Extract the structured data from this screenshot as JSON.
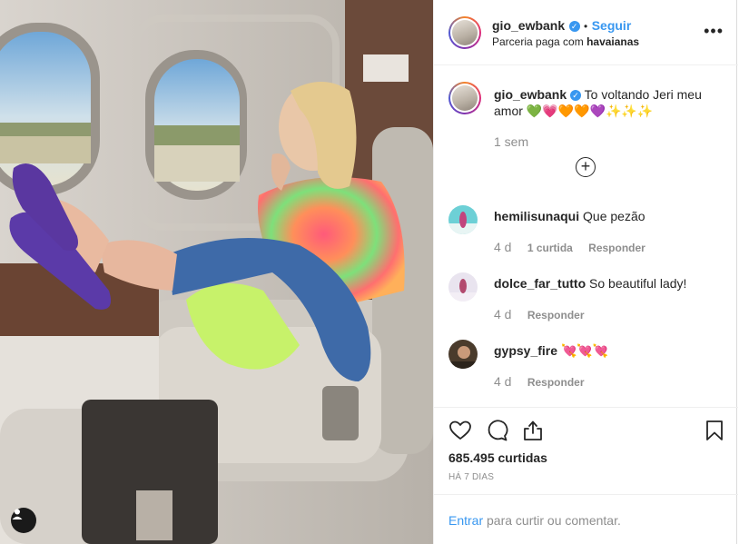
{
  "post": {
    "author": "gio_ewbank",
    "follow_label": "Seguir",
    "header_dot": "•",
    "partnership_prefix": "Parceria paga com",
    "partner": "havaianas",
    "more_icon": "more-horizontal-icon",
    "more_glyph": "•••"
  },
  "caption": {
    "author": "gio_ewbank",
    "text": "To voltando Jeri meu amor 💚💗🧡🧡💜✨✨✨",
    "time": "1 sem"
  },
  "load_more_glyph": "+",
  "comments": [
    {
      "username": "hemilisunaqui",
      "text": "Que pezão",
      "time": "4 d",
      "likes": "1 curtida",
      "reply": "Responder"
    },
    {
      "username": "dolce_far_tutto",
      "text": "So beautiful lady!",
      "time": "4 d",
      "likes": "",
      "reply": "Responder"
    },
    {
      "username": "gypsy_fire",
      "text": "💘💘💘",
      "time": "4 d",
      "likes": "",
      "reply": "Responder"
    }
  ],
  "footer": {
    "likes": "685.495 curtidas",
    "posted_ago": "HÁ 7 DIAS",
    "login_link": "Entrar",
    "login_suffix": "para curtir ou comentar."
  },
  "icons": {
    "like": "heart-icon",
    "comment": "comment-icon",
    "share": "share-icon",
    "save": "bookmark-icon",
    "photo_user": "user-tag-icon"
  },
  "colors": {
    "link_blue": "#3897f0",
    "text_primary": "#262626",
    "text_secondary": "#8e8e8e",
    "border": "#efefef"
  }
}
